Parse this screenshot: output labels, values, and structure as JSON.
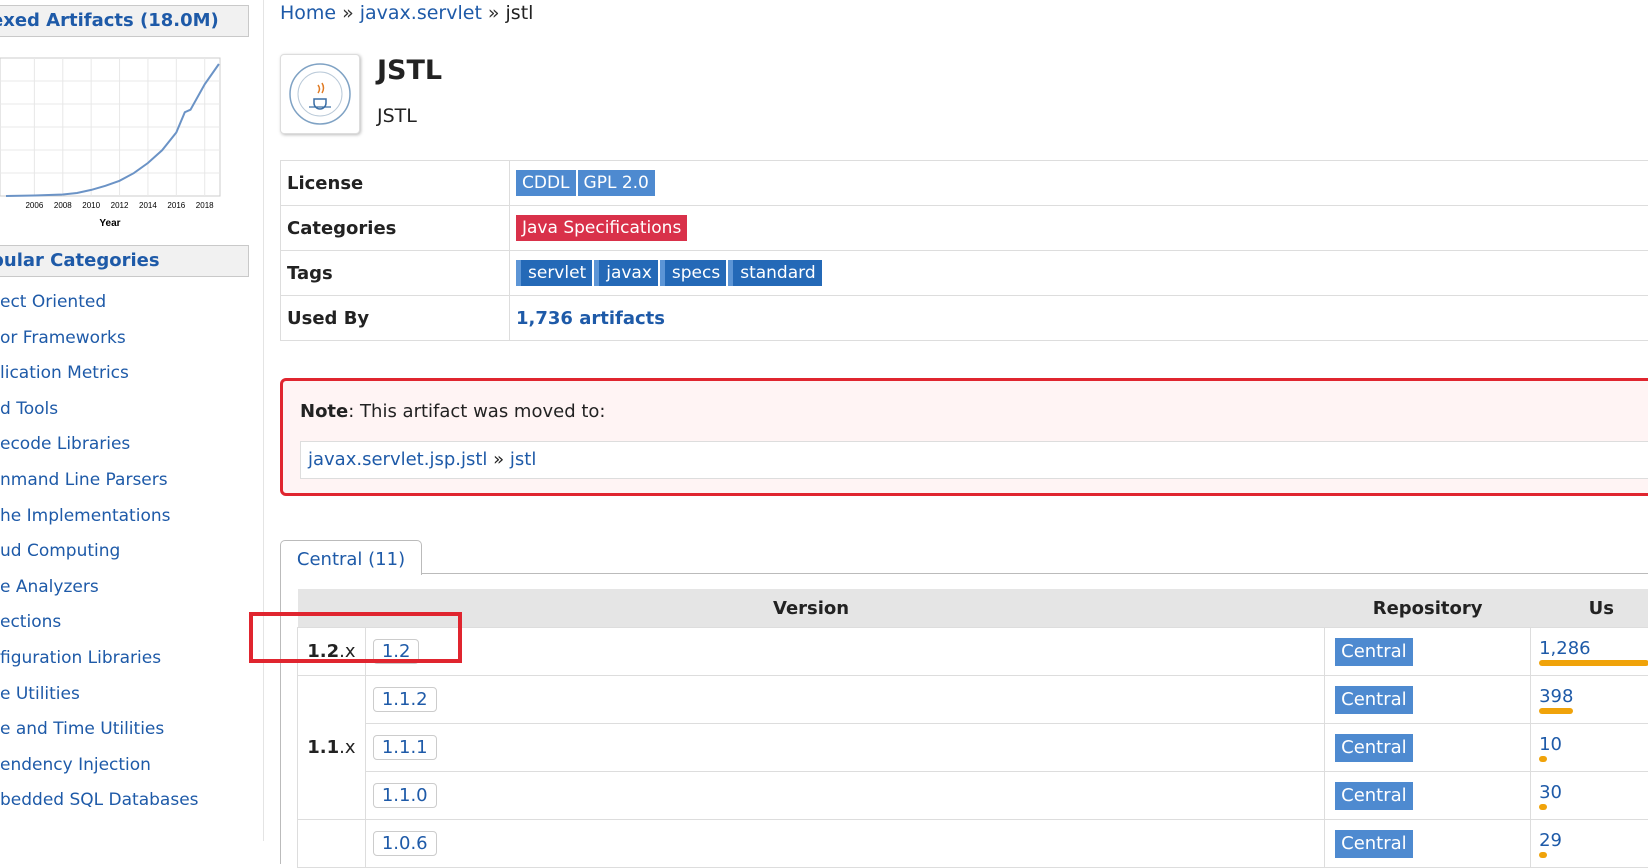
{
  "sidebar": {
    "indexed_heading": "exed Artifacts (18.0M)",
    "popular_heading": "pular Categories",
    "chart_data": {
      "type": "line",
      "xlabel": "Year",
      "x_ticks": [
        "2006",
        "2008",
        "2010",
        "2012",
        "2014",
        "2016",
        "2018"
      ],
      "x": [
        2004,
        2006,
        2008,
        2009,
        2010,
        2011,
        2012,
        2013,
        2014,
        2015,
        2016,
        2016.6,
        2017,
        2018,
        2019
      ],
      "y": [
        0.0,
        0.1,
        0.3,
        0.6,
        1.2,
        2.0,
        3.0,
        4.5,
        6.5,
        9.0,
        12.5,
        16.5,
        17.0,
        22.0,
        26.0
      ],
      "ylim": [
        0,
        26
      ]
    },
    "categories": [
      "ect Oriented",
      "or Frameworks",
      "lication Metrics",
      "d Tools",
      "ecode Libraries",
      "nmand Line Parsers",
      "he Implementations",
      "ud Computing",
      "e Analyzers",
      "ections",
      "figuration Libraries",
      "e Utilities",
      "e and Time Utilities",
      "endency Injection",
      "bedded SQL Databases"
    ]
  },
  "breadcrumb": {
    "home": "Home",
    "sep1": "»",
    "group": "javax.servlet",
    "sep2": "»",
    "current": "jstl"
  },
  "artifact": {
    "title": "JSTL",
    "subtitle": "JSTL",
    "logo_icon": "java-community-process-logo-icon"
  },
  "info": {
    "license_label": "License",
    "licenses": [
      "CDDL",
      "GPL 2.0"
    ],
    "categories_label": "Categories",
    "category": "Java Specifications",
    "tags_label": "Tags",
    "tags": [
      "servlet",
      "javax",
      "specs",
      "standard"
    ],
    "usedby_label": "Used By",
    "usedby": "1,736 artifacts"
  },
  "note": {
    "label": "Note",
    "text": ": This artifact was moved to:",
    "group": "javax.servlet.jsp.jstl",
    "sep": "»",
    "artifact": "jstl"
  },
  "versions": {
    "tab": "Central (11)",
    "headers": {
      "version": "Version",
      "repository": "Repository",
      "usages": "Us"
    },
    "group_12": {
      "bold": "1.2",
      "suffix": ".x"
    },
    "group_11": {
      "bold": "1.1",
      "suffix": ".x"
    },
    "rows": [
      {
        "version": "1.2",
        "repo": "Central",
        "usages": "1,286",
        "usage_fraction": 1.0
      },
      {
        "version": "1.1.2",
        "repo": "Central",
        "usages": "398",
        "usage_fraction": 0.31
      },
      {
        "version": "1.1.1",
        "repo": "Central",
        "usages": "10",
        "usage_fraction": 0.01
      },
      {
        "version": "1.1.0",
        "repo": "Central",
        "usages": "30",
        "usage_fraction": 0.02
      },
      {
        "version": "1.0.6",
        "repo": "Central",
        "usages": "29",
        "usage_fraction": 0.02
      }
    ]
  }
}
